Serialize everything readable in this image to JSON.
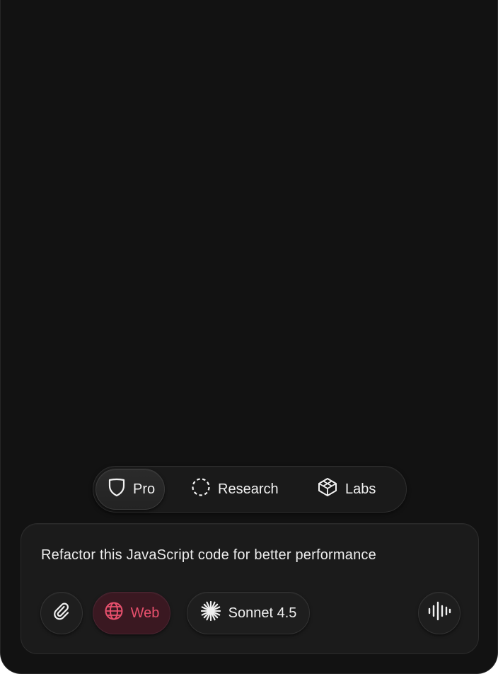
{
  "modes": [
    {
      "label": "Pro",
      "icon": "shield-icon",
      "active": true
    },
    {
      "label": "Research",
      "icon": "dashed-circle-icon",
      "active": false
    },
    {
      "label": "Labs",
      "icon": "cube-icon",
      "active": false
    }
  ],
  "composer": {
    "prompt_text": "Refactor this JavaScript code for better performance",
    "web_label": "Web",
    "model_label": "Sonnet 4.5"
  },
  "icons": {
    "attach": "paperclip-icon",
    "web": "globe-icon",
    "model": "sparkle-burst-icon",
    "voice": "waveform-icon"
  },
  "colors": {
    "background": "#121212",
    "accent": "#e8506d",
    "text": "#ececec"
  }
}
